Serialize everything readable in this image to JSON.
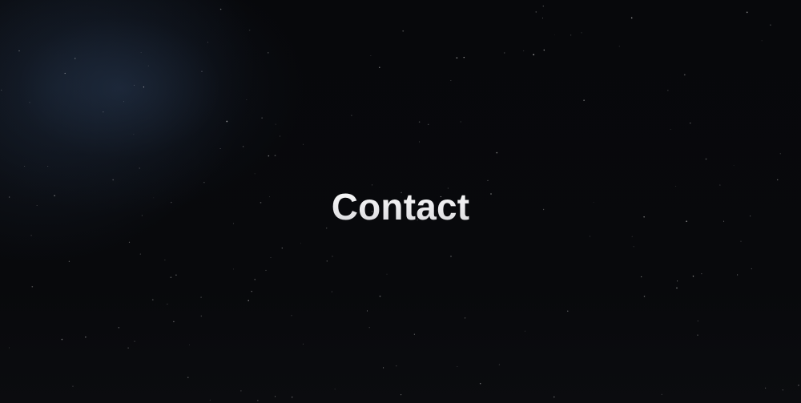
{
  "hero": {
    "title": "Contact"
  },
  "colors": {
    "background": "#07080b",
    "title": "#e9e9ec",
    "spotlight": "#263650",
    "star": "#ffffff"
  }
}
